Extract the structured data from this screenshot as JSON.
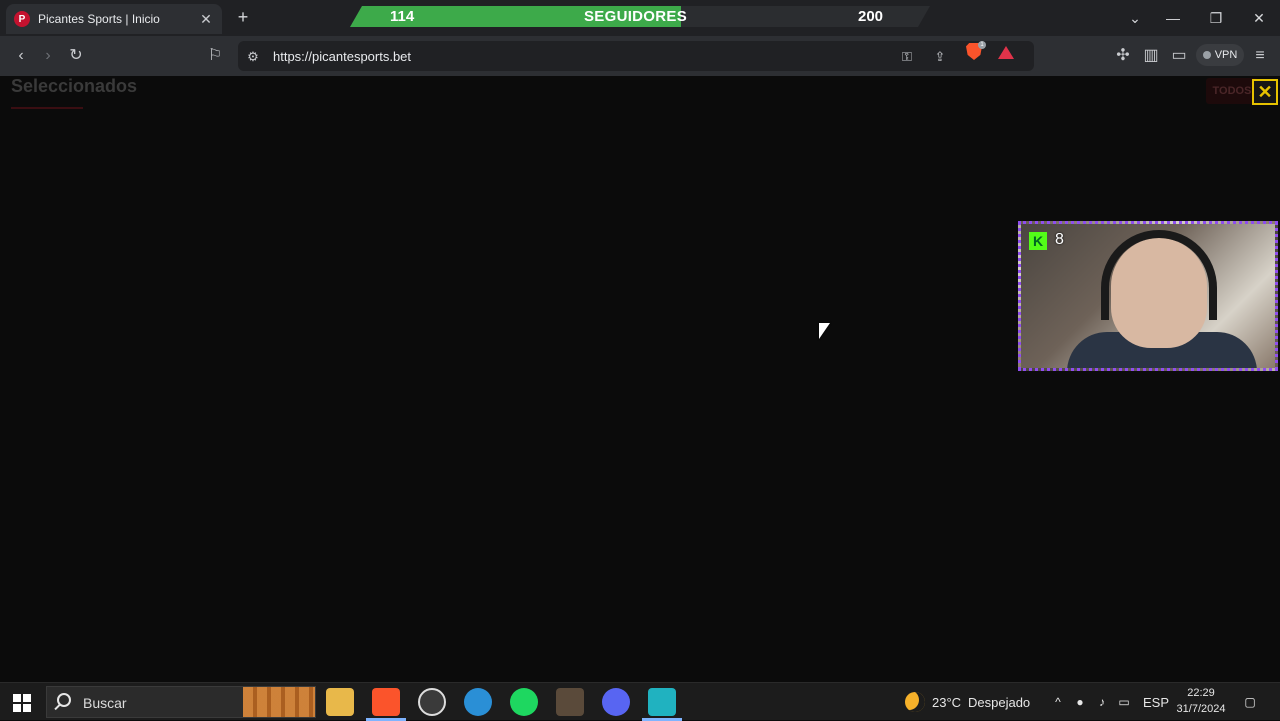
{
  "browser": {
    "tab": {
      "title": "Picantes Sports | Inicio",
      "favicon_letter": "P"
    },
    "url": "https://picantesports.bet",
    "vpn_label": "VPN",
    "brave_badge": "1"
  },
  "stream_overlay": {
    "followers_current": "114",
    "followers_label": "SEGUIDORES",
    "followers_goal": "200",
    "progress_fraction": 0.57,
    "viewer_count": "8",
    "kick_letter": "K"
  },
  "page": {
    "section_title": "Seleccionados",
    "todos_label": "TODOS",
    "close_label": "✕"
  },
  "taskbar": {
    "search_placeholder": "Buscar",
    "weather_temp": "23°C",
    "weather_desc": "Despejado",
    "language": "ESP",
    "time": "22:29",
    "date": "31/7/2024"
  },
  "colors": {
    "progress_green": "#3daa4a",
    "brand_red": "#c4122f",
    "webcam_border": "#8f4df0",
    "close_yellow": "#e6c200"
  }
}
